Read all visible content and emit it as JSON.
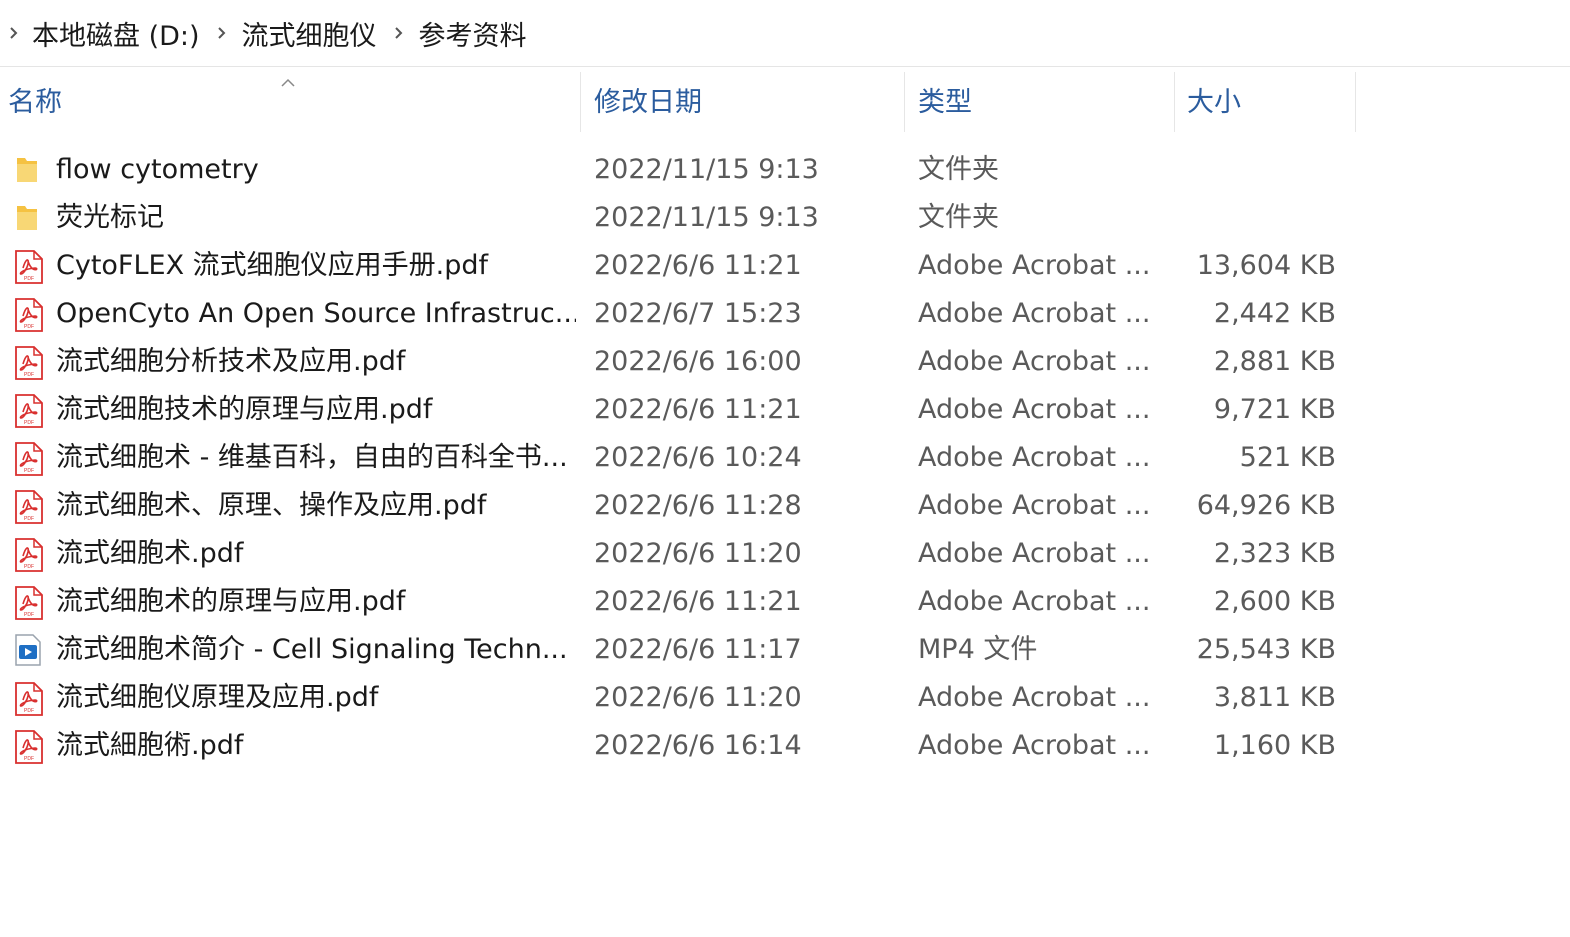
{
  "breadcrumb": {
    "items": [
      "本地磁盘 (D:)",
      "流式细胞仪",
      "参考资料"
    ]
  },
  "columns": {
    "name": "名称",
    "date": "修改日期",
    "type": "类型",
    "size": "大小"
  },
  "files": [
    {
      "icon": "folder-icon",
      "name": "flow cytometry",
      "date": "2022/11/15 9:13",
      "type": "文件夹",
      "size": ""
    },
    {
      "icon": "folder-icon",
      "name": "荧光标记",
      "date": "2022/11/15 9:13",
      "type": "文件夹",
      "size": ""
    },
    {
      "icon": "pdf-icon",
      "name": "CytoFLEX 流式细胞仪应用手册.pdf",
      "date": "2022/6/6 11:21",
      "type": "Adobe Acrobat ...",
      "size": "13,604 KB"
    },
    {
      "icon": "pdf-icon",
      "name": "OpenCyto An Open Source Infrastruc...",
      "date": "2022/6/7 15:23",
      "type": "Adobe Acrobat ...",
      "size": "2,442 KB"
    },
    {
      "icon": "pdf-icon",
      "name": "流式细胞分析技术及应用.pdf",
      "date": "2022/6/6 16:00",
      "type": "Adobe Acrobat ...",
      "size": "2,881 KB"
    },
    {
      "icon": "pdf-icon",
      "name": "流式细胞技术的原理与应用.pdf",
      "date": "2022/6/6 11:21",
      "type": "Adobe Acrobat ...",
      "size": "9,721 KB"
    },
    {
      "icon": "pdf-icon",
      "name": "流式细胞术 - 维基百科，自由的百科全书...",
      "date": "2022/6/6 10:24",
      "type": "Adobe Acrobat ...",
      "size": "521 KB"
    },
    {
      "icon": "pdf-icon",
      "name": "流式细胞术、原理、操作及应用.pdf",
      "date": "2022/6/6 11:28",
      "type": "Adobe Acrobat ...",
      "size": "64,926 KB"
    },
    {
      "icon": "pdf-icon",
      "name": "流式细胞术.pdf",
      "date": "2022/6/6 11:20",
      "type": "Adobe Acrobat ...",
      "size": "2,323 KB"
    },
    {
      "icon": "pdf-icon",
      "name": "流式细胞术的原理与应用.pdf",
      "date": "2022/6/6 11:21",
      "type": "Adobe Acrobat ...",
      "size": "2,600 KB"
    },
    {
      "icon": "video-icon",
      "name": "流式细胞术简介 - Cell Signaling Techn...",
      "date": "2022/6/6 11:17",
      "type": "MP4 文件",
      "size": "25,543 KB"
    },
    {
      "icon": "pdf-icon",
      "name": "流式细胞仪原理及应用.pdf",
      "date": "2022/6/6 11:20",
      "type": "Adobe Acrobat ...",
      "size": "3,811 KB"
    },
    {
      "icon": "pdf-icon",
      "name": "流式細胞術.pdf",
      "date": "2022/6/6 16:14",
      "type": "Adobe Acrobat ...",
      "size": "1,160 KB"
    }
  ],
  "colors": {
    "header_text": "#2b5c9e",
    "pdf_red": "#d9302f",
    "folder_yellow": "#f5c242"
  }
}
